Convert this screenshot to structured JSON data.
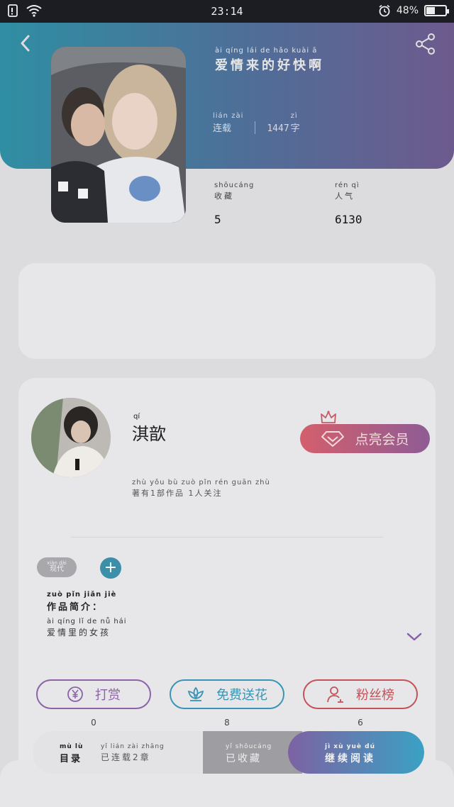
{
  "status_bar": {
    "time": "23:14",
    "battery_text": "48%",
    "battery_level": 0.48
  },
  "book": {
    "title_pinyin": "ài qíng lái de hǎo kuài ā",
    "title": "爱情来的好快啊",
    "status_pinyin": "lián zài",
    "status": "连载",
    "word_count": "1447",
    "word_unit_pinyin": "zì",
    "word_unit": "字"
  },
  "stats": {
    "favorites_pinyin": "shōucáng",
    "favorites_label": "收藏",
    "favorites_value": "5",
    "popularity_pinyin": "rén qì",
    "popularity_label": "人气",
    "popularity_value": "6130"
  },
  "author": {
    "name_pinyin": "qí",
    "name": "淇歆",
    "meta_pinyin": "zhù yǒu  bù zuò pǐn  rén guān zhù",
    "meta": "著有1部作品 1人关注",
    "member_button": "点亮会员"
  },
  "work": {
    "tag_pinyin": "xiàn dài",
    "tag": "现代",
    "add_tag_symbol": "+",
    "intro_title_pinyin": "zuò pǐn jiǎn jiè",
    "intro_title": "作品简介：",
    "intro_pinyin": "ài qíng lǐ de nǚ hái",
    "intro": "爱情里的女孩"
  },
  "actions": [
    {
      "label": "打赏",
      "count": "0",
      "color": "#8c63a8"
    },
    {
      "label": "免费送花",
      "count": "8",
      "color": "#3a94b4"
    },
    {
      "label": "粉丝榜",
      "count": "6",
      "color": "#c45259"
    }
  ],
  "bottom_bar": {
    "toc_pinyin": "mù lù",
    "toc": "目录",
    "updated_pinyin": "yǐ lián zài  zhāng",
    "updated": "已连载2章",
    "collected_pinyin": "yǐ shōucáng",
    "collected": "已收藏",
    "continue_pinyin": "jì xù yuè dú",
    "continue": "继续阅读"
  },
  "colors": {
    "accent_teal": "#2f8ea3",
    "accent_purple": "#6d5a8d",
    "member_red": "#d45f6c"
  }
}
